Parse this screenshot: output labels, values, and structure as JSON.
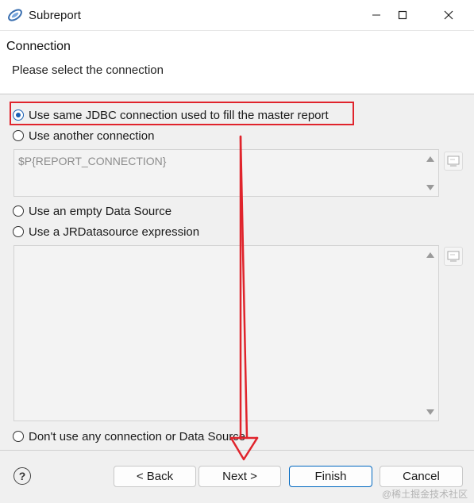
{
  "window": {
    "title": "Subreport",
    "app_icon": "eclipse-jaspersoft-icon"
  },
  "header": {
    "title": "Connection",
    "subtitle": "Please select the connection"
  },
  "options": [
    {
      "label": "Use same JDBC connection used to fill the master report",
      "checked": true
    },
    {
      "label": "Use another connection",
      "checked": false
    },
    {
      "label": "Use an empty Data Source",
      "checked": false
    },
    {
      "label": "Use a JRDatasource expression",
      "checked": false
    },
    {
      "label": "Don't use any connection or Data Source",
      "checked": false
    }
  ],
  "connection_expression": {
    "value": "$P{REPORT_CONNECTION}"
  },
  "datasource_expression": {
    "value": ""
  },
  "buttons": {
    "back": "< Back",
    "next": "Next >",
    "finish": "Finish",
    "cancel": "Cancel",
    "help": "?"
  },
  "watermark": "@稀土掘金技术社区",
  "colors": {
    "highlight": "#e0242c",
    "accent": "#0067c0"
  }
}
